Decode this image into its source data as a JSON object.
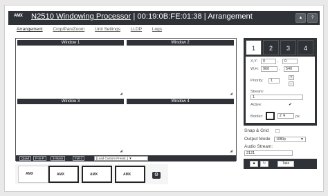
{
  "header": {
    "logo": "AMX",
    "device": "N2510 Windowing Processor",
    "sep1": " | ",
    "mac": "00:19:0B:FE:01:38",
    "sep2": " | ",
    "page": "Arrangement",
    "btn1": "▲",
    "btn2": "?"
  },
  "nav": [
    "Arrangement",
    "Crop/Pan/Zoom",
    "Unit Settings",
    "LLDP",
    "Logs"
  ],
  "windows": [
    "Window 1",
    "Window 2",
    "Window 3",
    "Window 4"
  ],
  "presets": {
    "buttons": [
      "Quad",
      "P-In-P",
      "3-Stack",
      "Full-1"
    ],
    "select": "[Load Custom Preset..]"
  },
  "thumbs": [
    "AMX",
    "AMX",
    "AMX",
    "AMX"
  ],
  "gear": "⚙",
  "panel": {
    "tabs": [
      "1",
      "2",
      "3",
      "4"
    ],
    "xy_label": "X,Y:",
    "x": "0",
    "y": "0",
    "comma": ",",
    "wh_label": "W,H:",
    "w": "960",
    "h": "540",
    "priority_label": "Priority:",
    "priority": "1",
    "plus": "+",
    "minus": "-",
    "stream_label": "Stream:",
    "stream": "1",
    "active_label": "Active:",
    "active_check": "✔",
    "border_label": "Border:",
    "border_value": "2",
    "border_unit": "px",
    "arrow": "▼"
  },
  "lower": {
    "snap_label": "Snap & Grid",
    "output_label": "Output Mode",
    "output_value": "1080p",
    "audio_label": "Audio Stream:",
    "audio_value": "2121"
  },
  "actions": {
    "save": "■",
    "refresh": "↻",
    "take": "Take"
  }
}
